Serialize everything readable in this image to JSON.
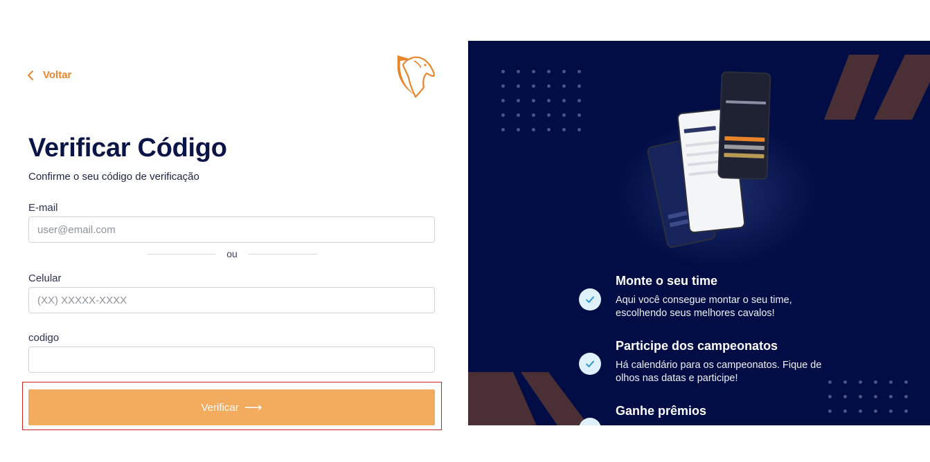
{
  "nav": {
    "back_label": "Voltar"
  },
  "page": {
    "title": "Verificar Código",
    "subtitle": "Confirme o seu código de verificação"
  },
  "form": {
    "email": {
      "label": "E-mail",
      "placeholder": "user@email.com",
      "value": ""
    },
    "separator": "ou",
    "phone": {
      "label": "Celular",
      "placeholder": "(XX) XXXXX-XXXX",
      "value": ""
    },
    "code": {
      "label": "codigo",
      "placeholder": "",
      "value": ""
    },
    "submit_label": "Verificar",
    "submit_icon": "arrow-right-icon"
  },
  "features": [
    {
      "title": "Monte o seu time",
      "text_line1": "Aqui você consegue montar o seu time,",
      "text_line2": "escolhendo seus melhores cavalos!",
      "icon": "check-icon"
    },
    {
      "title": "Participe dos campeonatos",
      "text_line1": "Há calendário para os campeonatos. Fique de",
      "text_line2": "olhos nas datas e participe!",
      "icon": "check-icon"
    },
    {
      "title": "Ganhe prêmios",
      "icon": "check-icon"
    }
  ],
  "colors": {
    "accent": "#e8852a",
    "button": "#f3ac5d",
    "panel_bg": "#010d44",
    "title": "#0b1447",
    "focus_outline": "#cc1f1f"
  }
}
